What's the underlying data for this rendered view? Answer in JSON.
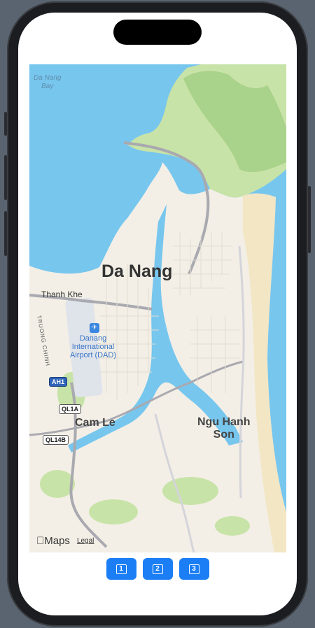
{
  "map": {
    "labels": {
      "bay": "Da Nang\nBay",
      "city": "Da Nang",
      "thanh_khe": "Thanh Khe",
      "cam_le": "Cam Le",
      "ngu_hanh_son": "Ngu Hanh\nSon",
      "airport": "Danang\nInternational\nAirport (DAD)",
      "street": "TRUONG CHINH"
    },
    "shields": {
      "ah1": "AH1",
      "ql1a": "QL1A",
      "ql14b": "QL14B"
    },
    "attribution": {
      "brand": "Maps",
      "legal": "Legal"
    },
    "colors": {
      "water": "#77c6ee",
      "land": "#f3efe6",
      "park": "#c8e3a7",
      "road": "#a9a9b0",
      "accent": "#1b7ef5"
    }
  },
  "buttons": [
    {
      "label": "1"
    },
    {
      "label": "2"
    },
    {
      "label": "3"
    }
  ]
}
